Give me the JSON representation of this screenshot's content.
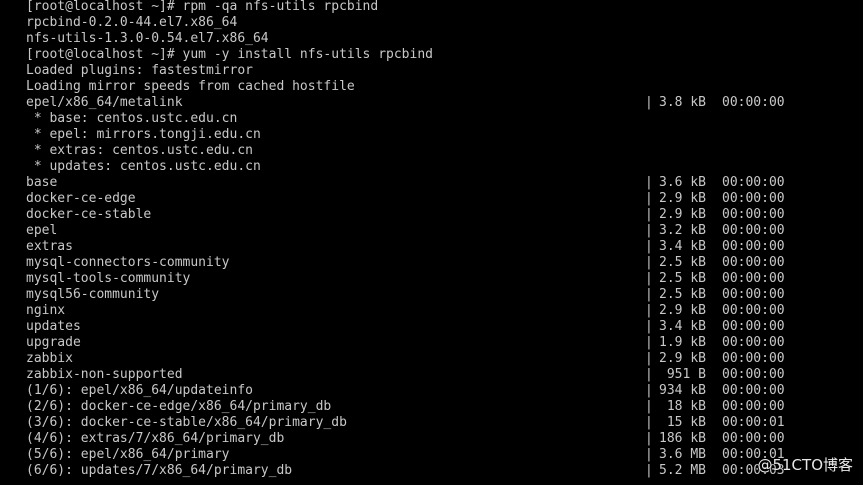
{
  "terminal": {
    "lines": [
      {
        "text": "[root@localhost ~]# rpm -qa nfs-utils rpcbind"
      },
      {
        "text": "rpcbind-0.2.0-44.el7.x86_64"
      },
      {
        "text": "nfs-utils-1.3.0-0.54.el7.x86_64"
      },
      {
        "text": "[root@localhost ~]# yum -y install nfs-utils rpcbind"
      },
      {
        "text": "Loaded plugins: fastestmirror"
      },
      {
        "text": "Loading mirror speeds from cached hostfile"
      },
      {
        "text": "epel/x86_64/metalink",
        "size": "3.8 kB",
        "time": "00:00:00"
      },
      {
        "text": " * base: centos.ustc.edu.cn"
      },
      {
        "text": " * epel: mirrors.tongji.edu.cn"
      },
      {
        "text": " * extras: centos.ustc.edu.cn"
      },
      {
        "text": " * updates: centos.ustc.edu.cn"
      },
      {
        "text": "base",
        "size": "3.6 kB",
        "time": "00:00:00"
      },
      {
        "text": "docker-ce-edge",
        "size": "2.9 kB",
        "time": "00:00:00"
      },
      {
        "text": "docker-ce-stable",
        "size": "2.9 kB",
        "time": "00:00:00"
      },
      {
        "text": "epel",
        "size": "3.2 kB",
        "time": "00:00:00"
      },
      {
        "text": "extras",
        "size": "3.4 kB",
        "time": "00:00:00"
      },
      {
        "text": "mysql-connectors-community",
        "size": "2.5 kB",
        "time": "00:00:00"
      },
      {
        "text": "mysql-tools-community",
        "size": "2.5 kB",
        "time": "00:00:00"
      },
      {
        "text": "mysql56-community",
        "size": "2.5 kB",
        "time": "00:00:00"
      },
      {
        "text": "nginx",
        "size": "2.9 kB",
        "time": "00:00:00"
      },
      {
        "text": "updates",
        "size": "3.4 kB",
        "time": "00:00:00"
      },
      {
        "text": "upgrade",
        "size": "1.9 kB",
        "time": "00:00:00"
      },
      {
        "text": "zabbix",
        "size": "2.9 kB",
        "time": "00:00:00"
      },
      {
        "text": "zabbix-non-supported",
        "size": "951 B",
        "time": "00:00:00"
      },
      {
        "text": "(1/6): epel/x86_64/updateinfo",
        "size": "934 kB",
        "time": "00:00:00"
      },
      {
        "text": "(2/6): docker-ce-edge/x86_64/primary_db",
        "size": "18 kB",
        "time": "00:00:00"
      },
      {
        "text": "(3/6): docker-ce-stable/x86_64/primary_db",
        "size": "15 kB",
        "time": "00:00:01"
      },
      {
        "text": "(4/6): extras/7/x86_64/primary_db",
        "size": "186 kB",
        "time": "00:00:00"
      },
      {
        "text": "(5/6): epel/x86_64/primary",
        "size": "3.6 MB",
        "time": "00:00:01"
      },
      {
        "text": "(6/6): updates/7/x86_64/primary_db",
        "size": "5.2 MB",
        "time": "00:00:03"
      }
    ],
    "separator": "|"
  },
  "watermark": {
    "text": "@51CTO博客"
  }
}
